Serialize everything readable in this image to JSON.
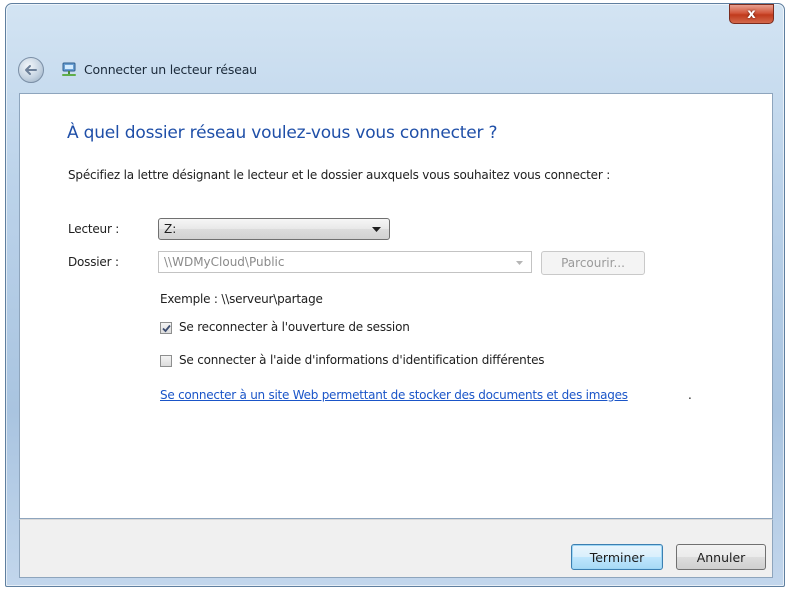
{
  "window": {
    "title": "Connecter un lecteur réseau",
    "close_symbol": "x"
  },
  "heading": "À quel dossier réseau voulez-vous vous connecter ?",
  "instruction": "Spécifiez la lettre désignant le lecteur et le dossier auxquels vous souhaitez vous connecter :",
  "drive": {
    "label": "Lecteur :",
    "value": "Z:"
  },
  "folder": {
    "label": "Dossier :",
    "value": "\\\\WDMyCloud\\Public",
    "browse_label": "Parcourir..."
  },
  "example": "Exemple : \\\\serveur\\partage",
  "options": {
    "reconnect": {
      "label": "Se reconnecter à l'ouverture de session",
      "checked": true
    },
    "credentials": {
      "label": "Se connecter à l'aide d'informations d'identification différentes",
      "checked": false
    }
  },
  "link": {
    "text": "Se connecter à un site Web permettant de stocker des documents et des images",
    "suffix": "."
  },
  "footer": {
    "finish_label": "Terminer",
    "cancel_label": "Annuler"
  },
  "icons": {
    "back": "back-arrow-icon",
    "title": "network-drive-icon",
    "dropdown": "chevron-down-icon",
    "check": "checkmark-icon"
  },
  "colors": {
    "heading": "#1f4fa8",
    "link": "#1a55c8",
    "close": "#c03a1c"
  }
}
